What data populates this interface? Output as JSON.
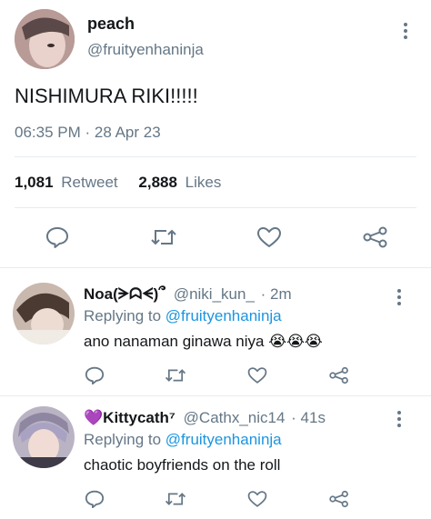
{
  "tweet": {
    "display_name": "peach",
    "handle": "@fruityenhaninja",
    "text": "NISHIMURA RIKI!!!!!",
    "timestamp": "06:35 PM · 28 Apr 23",
    "retweet_count": "1,081",
    "retweet_label": "Retweet",
    "like_count": "2,888",
    "like_label": "Likes"
  },
  "replies": [
    {
      "display_name": "Noa(ᗒᗣᗕ)՞",
      "handle": "@niki_kun_",
      "time": "· 2m",
      "replying_prefix": "Replying to",
      "replying_to": "@fruityenhaninja",
      "text": "ano nanaman ginawa niya 😭😭😭"
    },
    {
      "display_name": "💜Kittycath⁷",
      "handle": "@Cathx_nic14",
      "time": "· 41s",
      "replying_prefix": "Replying to",
      "replying_to": "@fruityenhaninja",
      "text": "chaotic boyfriends on the roll"
    }
  ],
  "icons": {
    "reply": "reply-icon",
    "retweet": "retweet-icon",
    "like": "heart-icon",
    "share": "share-icon",
    "more": "more-vertical-icon"
  },
  "colors": {
    "text": "#14171a",
    "muted": "#657786",
    "link": "#1b95e0",
    "divider": "#e6ecf0"
  }
}
